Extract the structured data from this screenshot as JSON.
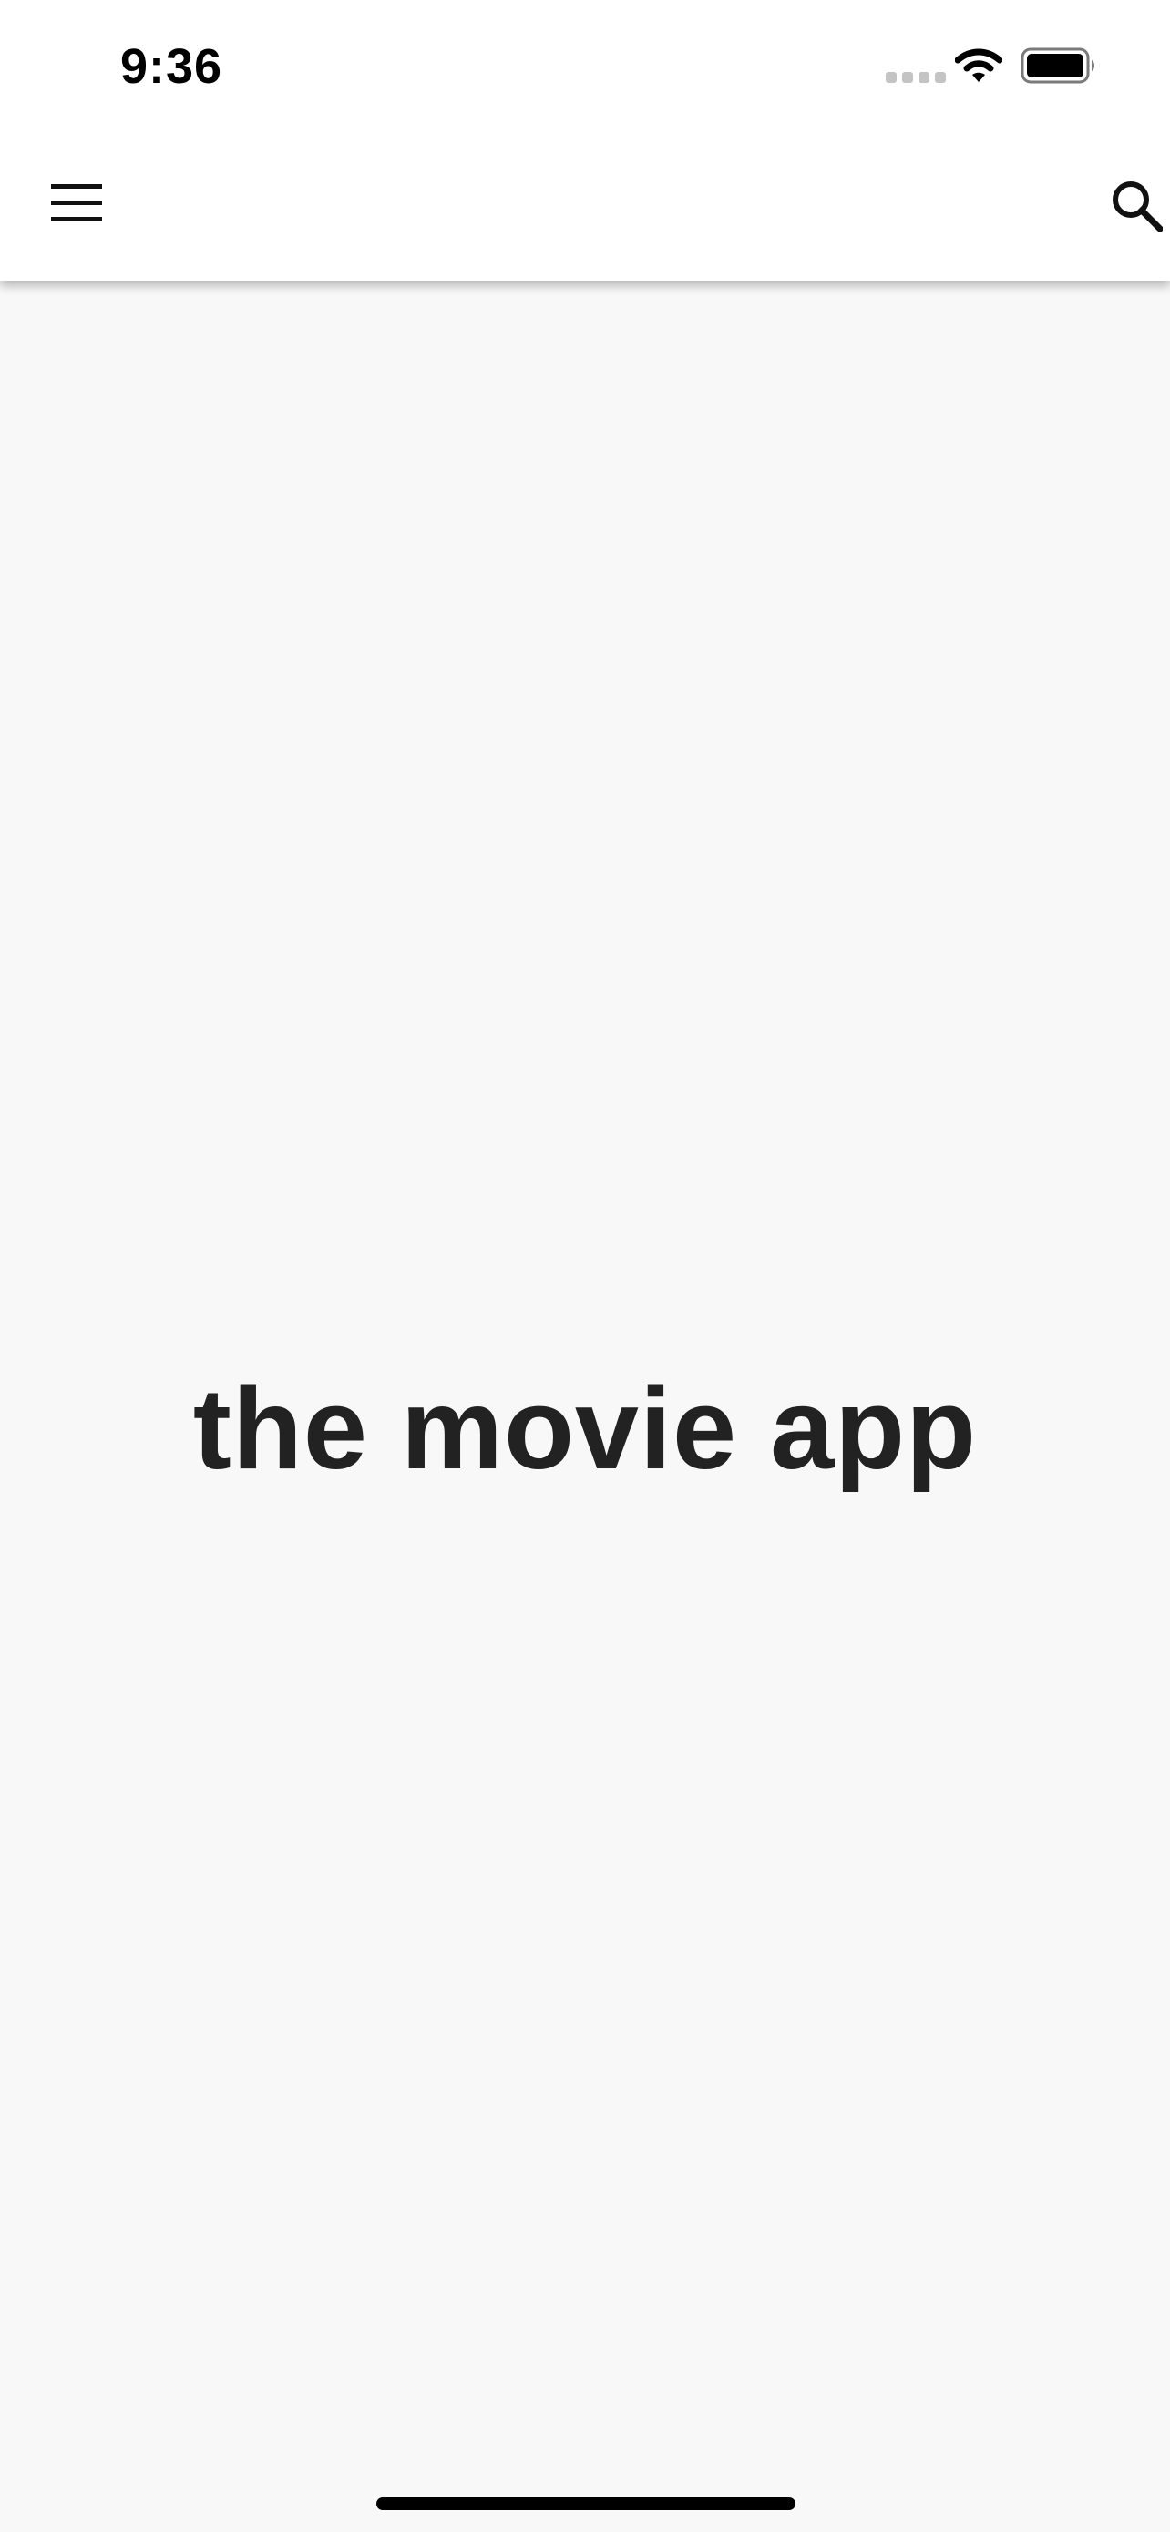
{
  "status_bar": {
    "time": "9:36"
  },
  "app_bar": {
    "menu_icon": "menu-icon",
    "search_icon": "search-icon"
  },
  "main": {
    "title": "the movie app"
  },
  "colors": {
    "background": "#f8f8f8",
    "header": "#ffffff",
    "title": "#222222",
    "icon": "#111111"
  }
}
